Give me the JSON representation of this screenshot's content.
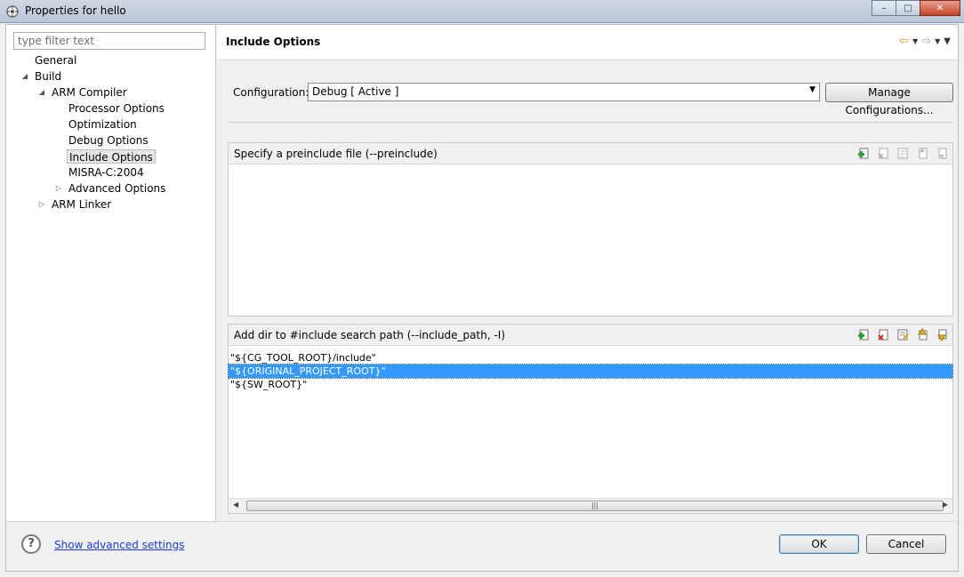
{
  "window": {
    "title": "Properties for hello",
    "minimize": "–",
    "maximize": "□",
    "close": "✕"
  },
  "filter": {
    "placeholder": "type filter text"
  },
  "tree": [
    {
      "label": "General",
      "level": 1,
      "twisty": ""
    },
    {
      "label": "Build",
      "level": 1,
      "twisty": "expanded"
    },
    {
      "label": "ARM Compiler",
      "level": 2,
      "twisty": "expanded"
    },
    {
      "label": "Processor Options",
      "level": 3,
      "twisty": ""
    },
    {
      "label": "Optimization",
      "level": 3,
      "twisty": ""
    },
    {
      "label": "Debug Options",
      "level": 3,
      "twisty": ""
    },
    {
      "label": "Include Options",
      "level": 3,
      "twisty": "",
      "selected": true
    },
    {
      "label": "MISRA-C:2004",
      "level": 3,
      "twisty": ""
    },
    {
      "label": "Advanced Options",
      "level": 3,
      "twisty": "collapsed"
    },
    {
      "label": "ARM Linker",
      "level": 2,
      "twisty": "collapsed"
    }
  ],
  "page": {
    "title": "Include Options",
    "nav": {
      "back": "⇦",
      "forward": "⇨",
      "dropdown": "▼"
    }
  },
  "config": {
    "label": "Configuration:",
    "value": "Debug  [ Active ]",
    "arrow": "▼",
    "manage_label": "Manage Configurations..."
  },
  "preinclude": {
    "title": "Specify a preinclude file (--preinclude)",
    "items": []
  },
  "include_path": {
    "title": "Add dir to #include search path (--include_path, -I)",
    "items": [
      "\"${CG_TOOL_ROOT}/include\"",
      "\"${ORIGINAL_PROJECT_ROOT}\"",
      "\"${SW_ROOT}\""
    ],
    "selected_index": 1
  },
  "scroll": {
    "left": "◀",
    "right": "▶",
    "grip": "|||"
  },
  "footer": {
    "help": "?",
    "advanced_link": "Show advanced settings",
    "ok": "OK",
    "cancel": "Cancel"
  },
  "colors": {
    "selection": "#3399ff",
    "link": "#1a3dd9"
  }
}
